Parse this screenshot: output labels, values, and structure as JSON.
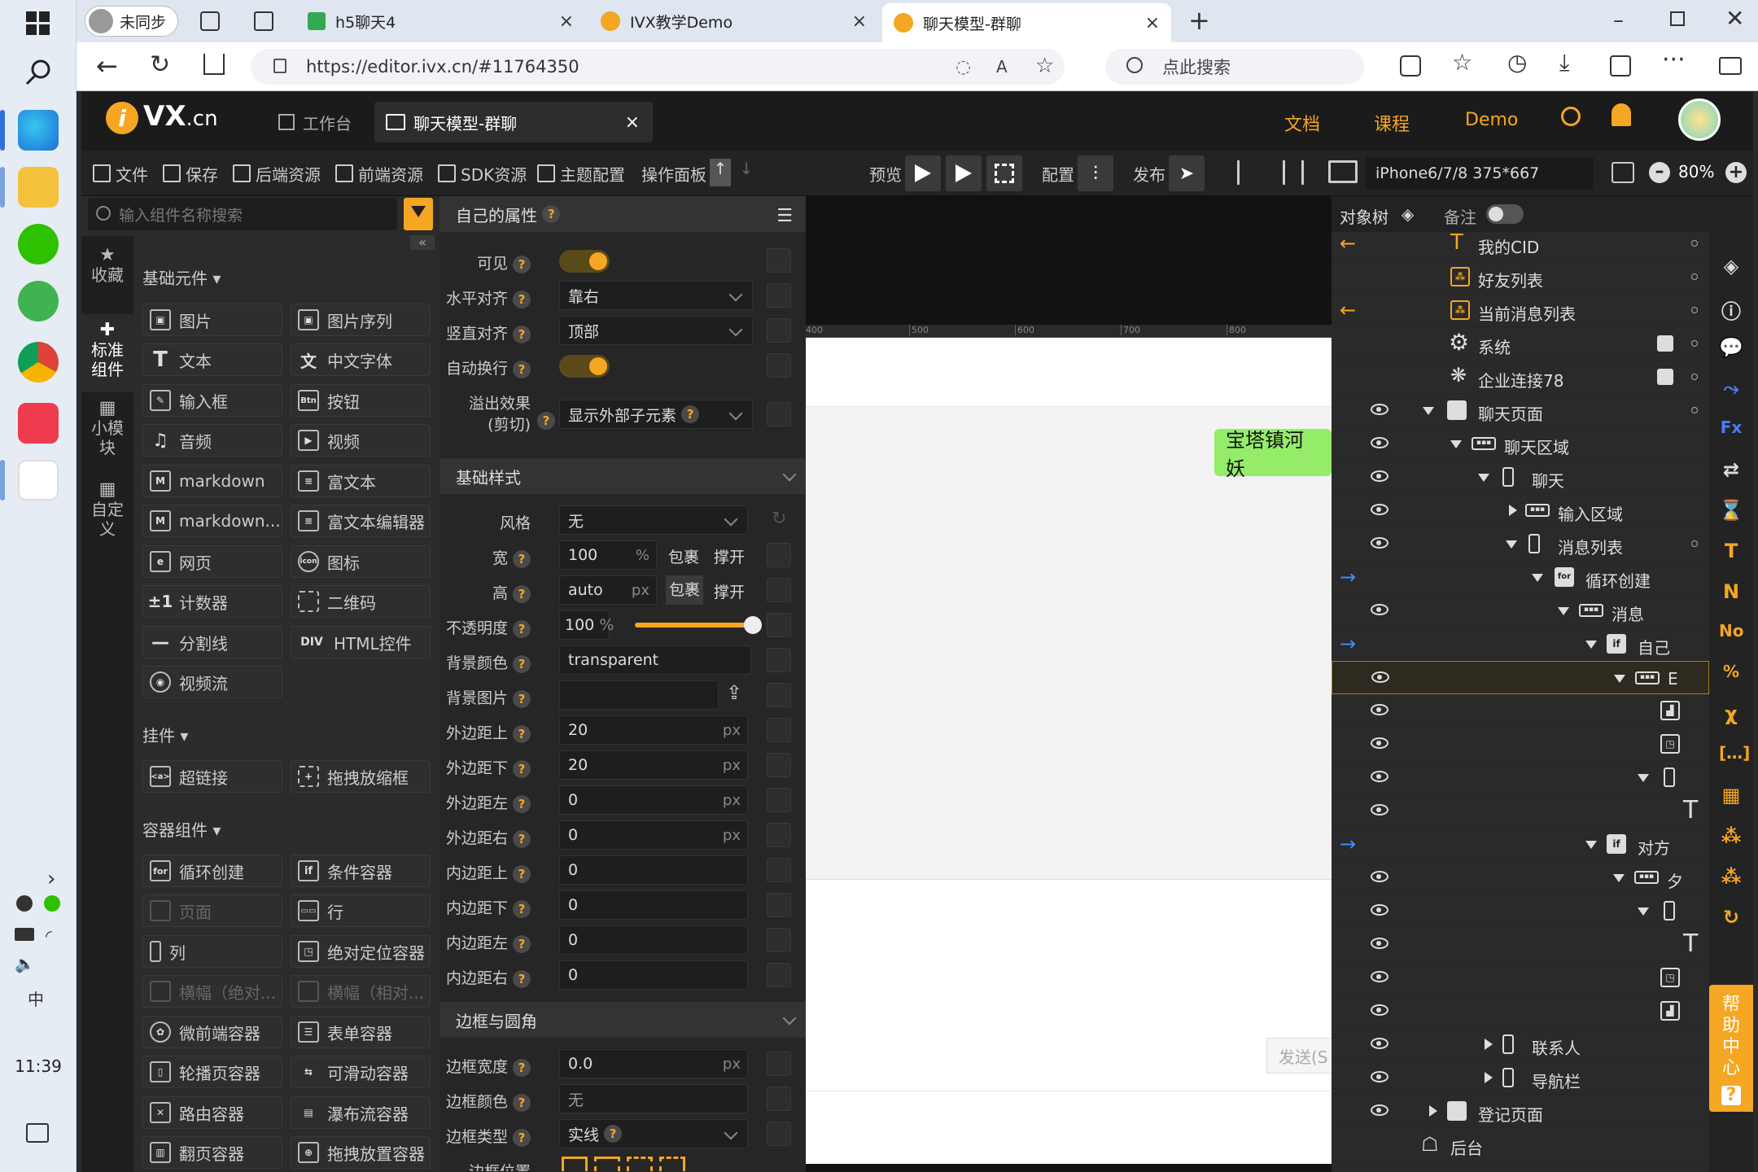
{
  "taskbar": {
    "time": "11:39"
  },
  "browser": {
    "profile": "未同步",
    "tabs": [
      {
        "title": "h5聊天4"
      },
      {
        "title": "IVX教学Demo"
      },
      {
        "title": "聊天模型-群聊"
      }
    ],
    "url": "https://editor.ivx.cn/#11764350",
    "search_placeholder": "点此搜索"
  },
  "app": {
    "logo": "VX",
    "logo_suffix": ".cn",
    "tabs": [
      {
        "label": "工作台"
      },
      {
        "label": "聊天模型-群聊"
      }
    ],
    "links": [
      "文档",
      "课程",
      "Demo"
    ],
    "accent": "#f5a623"
  },
  "toolbar": {
    "items": [
      "文件",
      "保存",
      "后端资源",
      "前端资源",
      "SDK资源",
      "主题配置",
      "操作面板"
    ],
    "preview": "预览",
    "config": "配置",
    "publish": "发布",
    "device": "iPhone6/7/8 375*667",
    "zoom": "80%"
  },
  "left": {
    "search_placeholder": "输入组件名称搜索",
    "side": [
      {
        "label": "收藏"
      },
      {
        "label": "标准组件"
      },
      {
        "label": "小模块"
      },
      {
        "label": "自定义"
      }
    ],
    "sections": [
      {
        "title": "基础元件",
        "items": [
          {
            "label": "图片",
            "icon": "image-icon"
          },
          {
            "label": "图片序列",
            "icon": "image-seq-icon"
          },
          {
            "label": "文本",
            "icon": "text-icon"
          },
          {
            "label": "中文字体",
            "icon": "font-icon"
          },
          {
            "label": "输入框",
            "icon": "input-icon"
          },
          {
            "label": "按钮",
            "icon": "btn-icon"
          },
          {
            "label": "音频",
            "icon": "audio-icon"
          },
          {
            "label": "视频",
            "icon": "video-icon"
          },
          {
            "label": "markdown",
            "icon": "md-icon"
          },
          {
            "label": "富文本",
            "icon": "richtext-icon"
          },
          {
            "label": "markdown...",
            "icon": "md-edit-icon"
          },
          {
            "label": "富文本编辑器",
            "icon": "richtext-editor-icon"
          },
          {
            "label": "网页",
            "icon": "web-icon"
          },
          {
            "label": "图标",
            "icon": "icon-icon"
          },
          {
            "label": "计数器",
            "icon": "counter-icon"
          },
          {
            "label": "二维码",
            "icon": "qrcode-icon"
          },
          {
            "label": "分割线",
            "icon": "divider-icon"
          },
          {
            "label": "HTML控件",
            "icon": "div-icon"
          },
          {
            "label": "视频流",
            "icon": "stream-icon"
          }
        ]
      },
      {
        "title": "挂件",
        "items": [
          {
            "label": "超链接",
            "icon": "link-icon"
          },
          {
            "label": "拖拽放缩框",
            "icon": "drag-icon"
          }
        ]
      },
      {
        "title": "容器组件",
        "items": [
          {
            "label": "循环创建",
            "icon": "for-icon"
          },
          {
            "label": "条件容器",
            "icon": "if-icon"
          },
          {
            "label": "页面",
            "icon": "page-icon"
          },
          {
            "label": "行",
            "icon": "row-icon"
          },
          {
            "label": "列",
            "icon": "col-icon"
          },
          {
            "label": "绝对定位容器",
            "icon": "abs-icon"
          },
          {
            "label": "横幅（绝对...",
            "icon": "banner-icon"
          },
          {
            "label": "横幅（相对...",
            "icon": "banner2-icon"
          },
          {
            "label": "微前端容器",
            "icon": "micro-icon"
          },
          {
            "label": "表单容器",
            "icon": "form-icon"
          },
          {
            "label": "轮播页容器",
            "icon": "carousel-icon"
          },
          {
            "label": "可滑动容器",
            "icon": "slide-icon"
          },
          {
            "label": "路由容器",
            "icon": "router-icon"
          },
          {
            "label": "瀑布流容器",
            "icon": "waterfall-icon"
          },
          {
            "label": "翻页容器",
            "icon": "pager-icon"
          },
          {
            "label": "拖拽放置容器",
            "icon": "drop-icon"
          }
        ]
      }
    ]
  },
  "props": {
    "title": "自己的属性",
    "visible": "可见",
    "halign": "水平对齐",
    "halign_val": "靠右",
    "valign": "竖直对齐",
    "valign_val": "顶部",
    "wrap": "自动换行",
    "overflow": "溢出效果",
    "overflow_sub": "(剪切)",
    "overflow_val": "显示外部子元素",
    "basic": "基础样式",
    "style": "风格",
    "style_val": "无",
    "width": "宽",
    "width_val": "100",
    "width_unit": "%",
    "height": "高",
    "height_val": "auto",
    "height_unit": "px",
    "wrapc": "包裹",
    "stretch": "撑开",
    "opacity": "不透明度",
    "opacity_val": "100",
    "opacity_unit": "%",
    "opacity_level": 1.0,
    "bg": "背景颜色",
    "bg_val": "transparent",
    "bgimg": "背景图片",
    "mt": "外边距上",
    "mt_val": "20",
    "mb": "外边距下",
    "mb_val": "20",
    "ml": "外边距左",
    "ml_val": "0",
    "mr": "外边距右",
    "mr_val": "0",
    "pt": "内边距上",
    "pt_val": "0",
    "pb": "内边距下",
    "pb_val": "0",
    "pl": "内边距左",
    "pl_val": "0",
    "pr": "内边距右",
    "pr_val": "0",
    "px": "px",
    "border": "边框与圆角",
    "bw": "边框宽度",
    "bw_val": "0.0",
    "bc": "边框颜色",
    "bc_val": "无",
    "bt": "边框类型",
    "bt_val": "实线",
    "bp": "边框位置"
  },
  "canvas": {
    "ruler": [
      "400",
      "500",
      "600",
      "700",
      "800"
    ],
    "bubble": "宝塔镇河妖",
    "bubble_color": "#95ec69",
    "send": "发送(S"
  },
  "tree": {
    "title": "对象树",
    "note": "备注",
    "rows": [
      {
        "label": "我的CID"
      },
      {
        "label": "好友列表"
      },
      {
        "label": "当前消息列表"
      },
      {
        "label": "系统"
      },
      {
        "label": "企业连接78"
      },
      {
        "label": "聊天页面"
      },
      {
        "label": "聊天区域"
      },
      {
        "label": "聊天"
      },
      {
        "label": "输入区域"
      },
      {
        "label": "消息列表"
      },
      {
        "label": "循环创建"
      },
      {
        "label": "消息"
      },
      {
        "label": "自己"
      },
      {
        "label": "E"
      },
      {
        "label": ""
      },
      {
        "label": ""
      },
      {
        "label": ""
      },
      {
        "label": ""
      },
      {
        "label": "对方"
      },
      {
        "label": "夕"
      },
      {
        "label": ""
      },
      {
        "label": ""
      },
      {
        "label": ""
      },
      {
        "label": ""
      },
      {
        "label": "联系人"
      },
      {
        "label": "导航栏"
      },
      {
        "label": "登记页面"
      },
      {
        "label": "后台"
      }
    ]
  },
  "help": "帮助中心"
}
